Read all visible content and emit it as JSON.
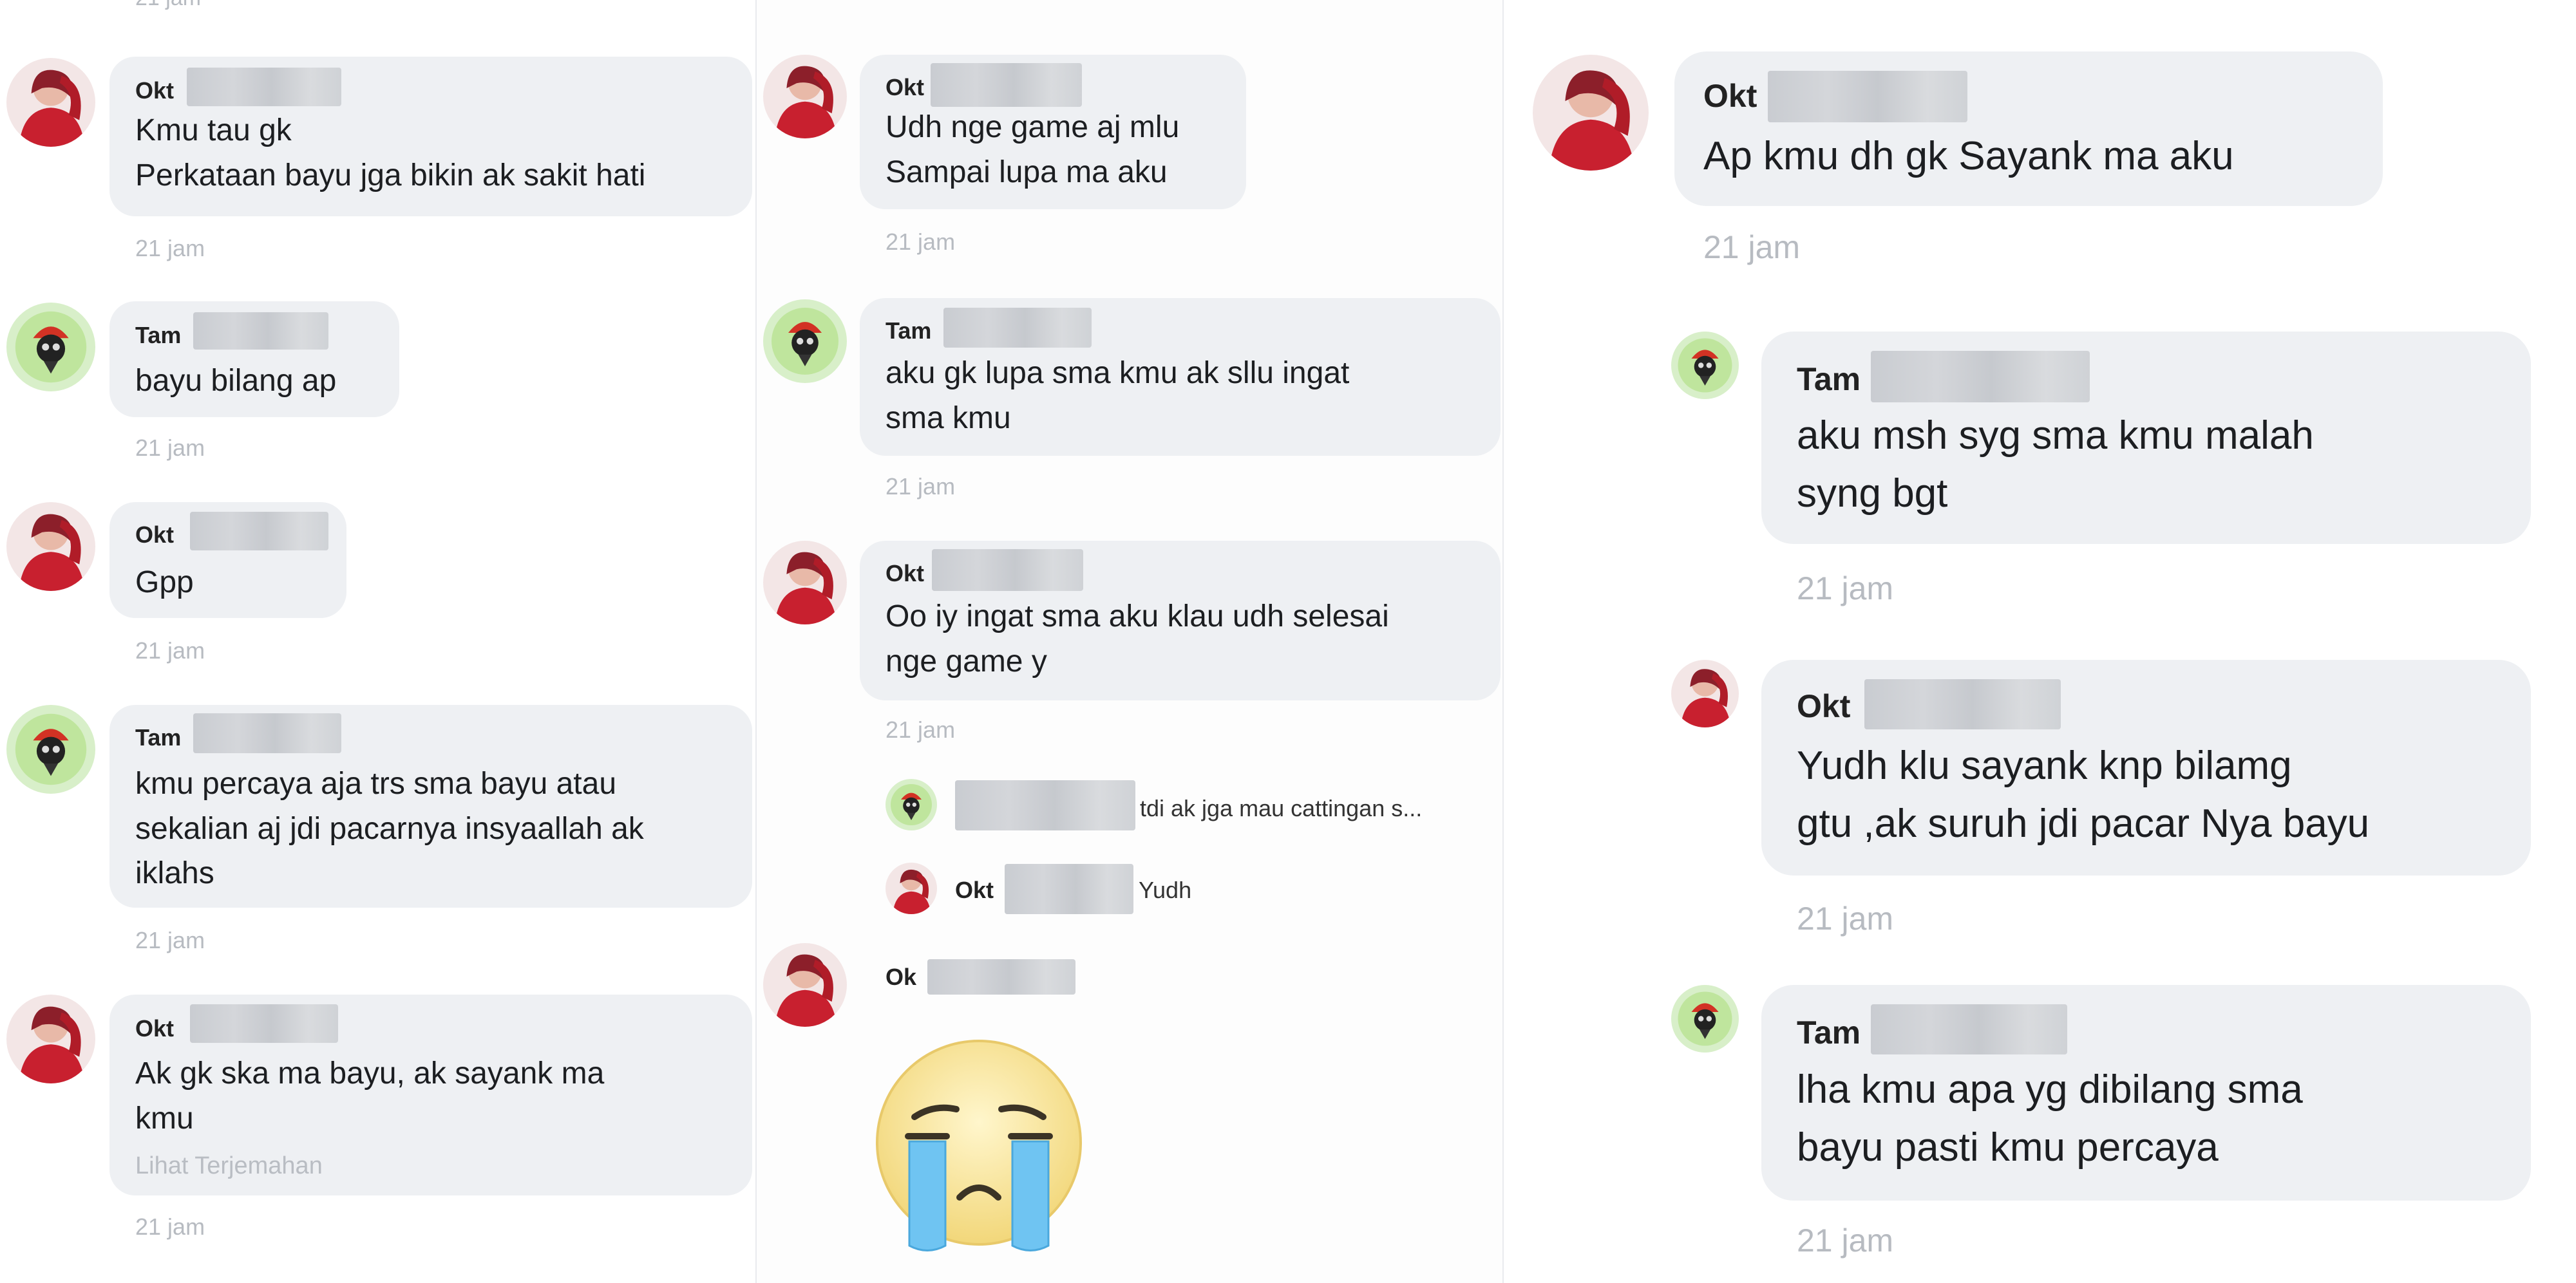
{
  "panel1": {
    "top_time": "21 jam",
    "comments": [
      {
        "name": "Okt",
        "text": "Kmu tau gk\nPerkataan bayu jga bikin ak sakit hati",
        "time": "21 jam"
      },
      {
        "name": "Tam",
        "text": "bayu bilang ap",
        "time": "21 jam"
      },
      {
        "name": "Okt",
        "text": "Gpp",
        "time": "21 jam"
      },
      {
        "name": "Tam",
        "text": "kmu percaya aja trs sma bayu atau\nsekalian aj jdi pacarnya insyaallah ak\niklahs",
        "time": "21 jam"
      },
      {
        "name": "Okt",
        "text": "Ak gk ska ma bayu, ak sayank ma\nkmu",
        "translate": "Lihat Terjemahan",
        "time": "21 jam"
      }
    ]
  },
  "panel2": {
    "comments": [
      {
        "name": "Okt",
        "text": "Udh nge game aj mlu\nSampai lupa ma aku",
        "time": "21 jam"
      },
      {
        "name": "Tam",
        "text": "aku gk lupa sma kmu ak sllu ingat\nsma kmu",
        "time": "21 jam"
      },
      {
        "name": "Okt",
        "text": "Oo iy ingat sma aku klau udh selesai\nnge game y",
        "time": "21 jam"
      }
    ],
    "replies": [
      {
        "text": "tdi ak jga mau cattingan s..."
      },
      {
        "name": "Okt",
        "text": "Yudh"
      }
    ],
    "last_comment": {
      "name": "Ok",
      "sticker": "crying-face-sticker"
    }
  },
  "panel3": {
    "comments": [
      {
        "name": "Okt",
        "text": "Ap kmu dh gk Sayank ma aku",
        "time": "21 jam"
      },
      {
        "name": "Tam",
        "text": "aku msh syg sma kmu malah\nsyng bgt",
        "time": "21 jam"
      },
      {
        "name": "Okt",
        "text": "Yudh klu sayank knp bilamg\ngtu  ,ak suruh jdi pacar Nya bayu",
        "time": "21 jam"
      },
      {
        "name": "Tam",
        "text": "lha kmu apa yg dibilang sma\nbayu pasti kmu percaya",
        "time": "21 jam"
      }
    ]
  },
  "colors": {
    "bubble": "#eef0f3",
    "time": "#b7bbc1",
    "redacted": "#c9ccd1"
  }
}
